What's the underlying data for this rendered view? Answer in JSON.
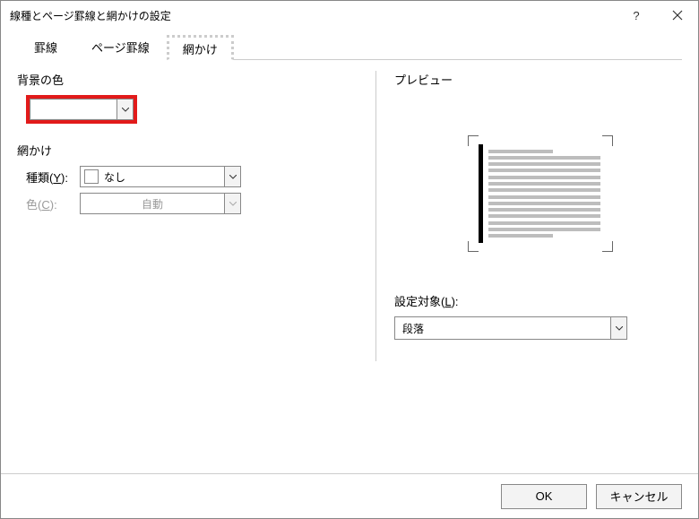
{
  "titlebar": {
    "title": "線種とページ罫線と網かけの設定"
  },
  "tabs": {
    "borders": "罫線",
    "page_borders": "ページ罫線",
    "shading": "網かけ"
  },
  "left": {
    "bg_label": "背景の色",
    "shade_label": "網かけ",
    "type_label_prefix": "種類(",
    "type_label_key": "Y",
    "type_label_suffix": "):",
    "type_value": "なし",
    "color_label_prefix": "色(",
    "color_label_key": "C",
    "color_label_suffix": "):",
    "color_value": "自動"
  },
  "right": {
    "preview_label": "プレビュー",
    "apply_label_prefix": "設定対象(",
    "apply_label_key": "L",
    "apply_label_suffix": "):",
    "apply_value": "段落"
  },
  "footer": {
    "ok": "OK",
    "cancel": "キャンセル"
  }
}
